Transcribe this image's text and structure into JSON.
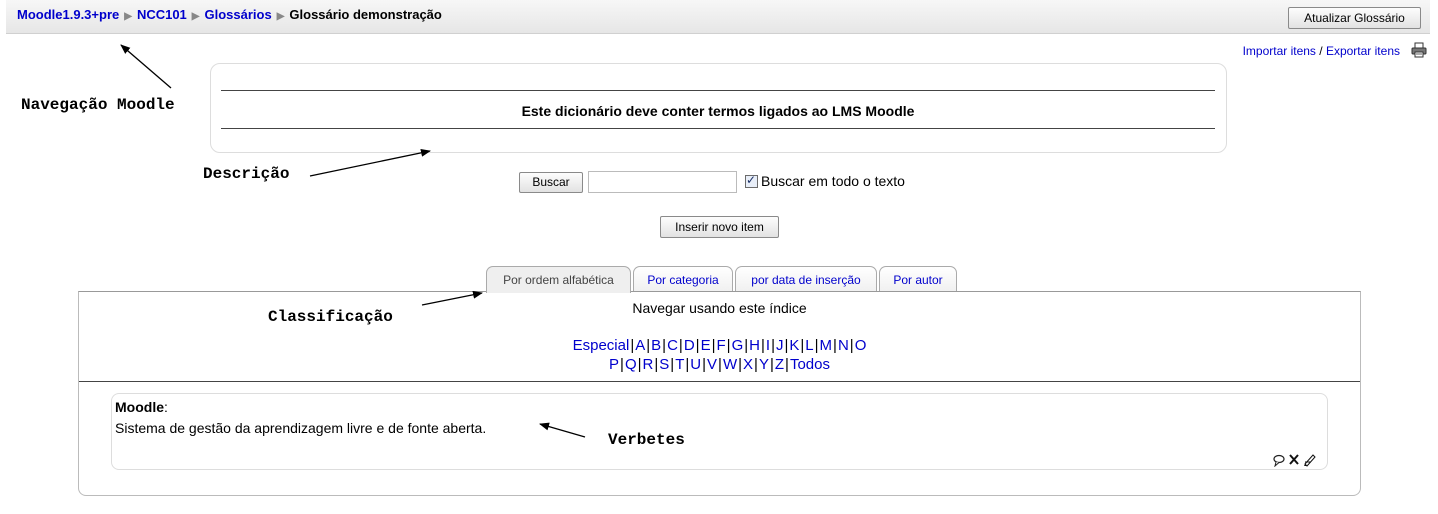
{
  "breadcrumb": {
    "items": [
      "Moodle1.9.3+pre",
      "NCC101",
      "Glossários"
    ],
    "current": "Glossário demonstração"
  },
  "header": {
    "update_button": "Atualizar Glossário",
    "import_label": "Importar itens",
    "link_separator": "/",
    "export_label": "Exportar itens",
    "print_icon": "printer-icon"
  },
  "description": {
    "text": "Este dicionário deve conter termos ligados ao LMS Moodle"
  },
  "search": {
    "button_label": "Buscar",
    "value": "",
    "fulltext_checked": true,
    "fulltext_label": "Buscar em todo o texto"
  },
  "insert_button": "Inserir novo item",
  "tabs": [
    {
      "label": "Por ordem alfabética",
      "active": true
    },
    {
      "label": "Por categoria",
      "active": false
    },
    {
      "label": "por data de inserção",
      "active": false
    },
    {
      "label": "Por autor",
      "active": false
    }
  ],
  "browse": {
    "title": "Navegar usando este índice",
    "row1": [
      "Especial",
      "A",
      "B",
      "C",
      "D",
      "E",
      "F",
      "G",
      "H",
      "I",
      "J",
      "K",
      "L",
      "M",
      "N",
      "O"
    ],
    "row2": [
      "P",
      "Q",
      "R",
      "S",
      "T",
      "U",
      "V",
      "W",
      "X",
      "Y",
      "Z",
      "Todos"
    ]
  },
  "entry": {
    "term": "Moodle",
    "colon": ":",
    "definition": "Sistema de gestão da aprendizagem livre e de fonte aberta.",
    "icons": [
      "comment-icon",
      "delete-icon",
      "edit-icon"
    ]
  },
  "annotations": {
    "nav": "Navegação Moodle",
    "description": "Descrição",
    "classification": "Classificação",
    "entries": "Verbetes"
  },
  "colors": {
    "link": "#0000cc",
    "border": "#dddddd"
  }
}
